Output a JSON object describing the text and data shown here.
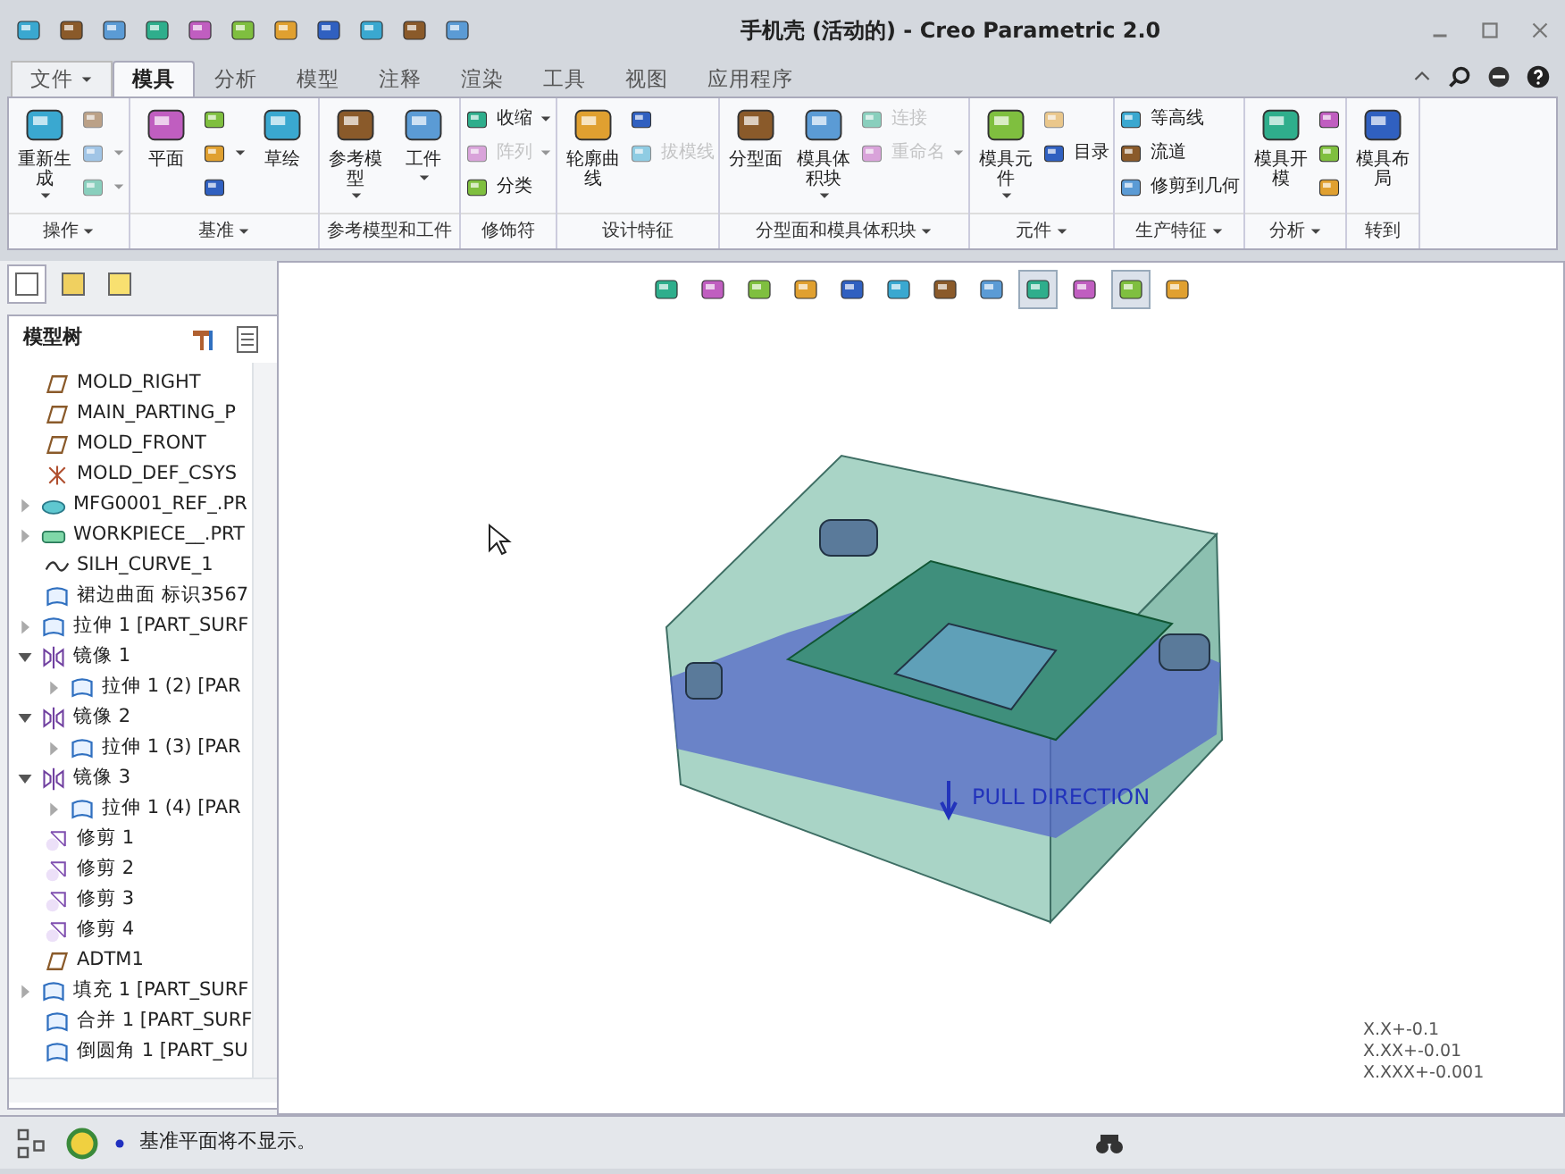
{
  "window": {
    "title": "手机壳 (活动的) - Creo Parametric 2.0"
  },
  "ribbon_tabs": [
    {
      "label": "文件",
      "kind": "menu",
      "selected": false
    },
    {
      "label": "模具",
      "kind": "tab",
      "selected": true
    },
    {
      "label": "分析",
      "kind": "tab",
      "selected": false
    },
    {
      "label": "模型",
      "kind": "tab",
      "selected": false
    },
    {
      "label": "注释",
      "kind": "tab",
      "selected": false
    },
    {
      "label": "渲染",
      "kind": "tab",
      "selected": false
    },
    {
      "label": "工具",
      "kind": "tab",
      "selected": false
    },
    {
      "label": "视图",
      "kind": "tab",
      "selected": false
    },
    {
      "label": "应用程序",
      "kind": "tab",
      "selected": false
    }
  ],
  "ribbon_groups": [
    {
      "label": "操作",
      "dropdown": true,
      "commands": [
        {
          "kind": "large",
          "label": "重新生成",
          "dropdown": true,
          "disabled": false
        },
        {
          "kind": "stack",
          "items": [
            {
              "disabled": true,
              "dropdown": false
            },
            {
              "disabled": true,
              "dropdown": true
            },
            {
              "disabled": true,
              "dropdown": true
            }
          ]
        }
      ]
    },
    {
      "label": "基准",
      "dropdown": true,
      "commands": [
        {
          "kind": "large",
          "label": "平面",
          "dropdown": false,
          "disabled": false
        },
        {
          "kind": "stack",
          "items": [
            {
              "disabled": false,
              "dropdown": false
            },
            {
              "disabled": false,
              "dropdown": true
            },
            {
              "disabled": false,
              "dropdown": false
            }
          ]
        },
        {
          "kind": "large",
          "label": "草绘",
          "dropdown": false,
          "disabled": false
        }
      ]
    },
    {
      "label": "参考模型和工件",
      "dropdown": false,
      "commands": [
        {
          "kind": "large",
          "label": "参考模型",
          "dropdown": true,
          "disabled": false
        },
        {
          "kind": "large",
          "label": "工件",
          "dropdown": true,
          "disabled": false
        }
      ]
    },
    {
      "label": "修饰符",
      "dropdown": false,
      "commands": [
        {
          "kind": "stack",
          "items": [
            {
              "label": "收缩",
              "disabled": false,
              "dropdown": true
            },
            {
              "label": "阵列",
              "disabled": true,
              "dropdown": true
            },
            {
              "label": "分类",
              "disabled": false,
              "dropdown": false
            }
          ]
        }
      ]
    },
    {
      "label": "设计特征",
      "dropdown": false,
      "commands": [
        {
          "kind": "large",
          "label": "轮廓曲线",
          "dropdown": false,
          "disabled": false
        },
        {
          "kind": "stack",
          "items": [
            {
              "disabled": false,
              "dropdown": false
            },
            {
              "label": "拔模线",
              "disabled": true,
              "dropdown": false
            }
          ]
        }
      ]
    },
    {
      "label": "分型面和模具体积块",
      "dropdown": true,
      "commands": [
        {
          "kind": "large",
          "label": "分型面",
          "dropdown": false,
          "disabled": false
        },
        {
          "kind": "large",
          "label": "模具体积块",
          "dropdown": true,
          "disabled": false
        },
        {
          "kind": "stack",
          "items": [
            {
              "label": "连接",
              "disabled": true,
              "dropdown": false
            },
            {
              "label": "重命名",
              "disabled": true,
              "dropdown": true
            }
          ]
        }
      ]
    },
    {
      "label": "元件",
      "dropdown": true,
      "commands": [
        {
          "kind": "large",
          "label": "模具元件",
          "dropdown": true,
          "disabled": false
        },
        {
          "kind": "stack",
          "items": [
            {
              "disabled": true,
              "dropdown": false
            },
            {
              "label": "目录",
              "disabled": false,
              "dropdown": false
            }
          ]
        }
      ]
    },
    {
      "label": "生产特征",
      "dropdown": true,
      "commands": [
        {
          "kind": "stack",
          "items": [
            {
              "label": "等高线",
              "disabled": false,
              "dropdown": false
            },
            {
              "label": "流道",
              "disabled": false,
              "dropdown": false
            },
            {
              "label": "修剪到几何",
              "disabled": false,
              "dropdown": false
            }
          ]
        }
      ]
    },
    {
      "label": "分析",
      "dropdown": true,
      "commands": [
        {
          "kind": "large",
          "label": "模具开模",
          "dropdown": false,
          "disabled": false
        },
        {
          "kind": "stack",
          "items": [
            {
              "disabled": false,
              "dropdown": false
            },
            {
              "disabled": false,
              "dropdown": false
            },
            {
              "disabled": false,
              "dropdown": false
            }
          ]
        }
      ]
    },
    {
      "label": "转到",
      "dropdown": false,
      "commands": [
        {
          "kind": "large",
          "label": "模具布局",
          "dropdown": false,
          "disabled": false
        }
      ]
    }
  ],
  "navigator_tabs": [
    {
      "selected": true
    },
    {
      "selected": false
    },
    {
      "selected": false
    }
  ],
  "model_tree": {
    "title": "模型树",
    "items": [
      {
        "label": "MOLD_RIGHT",
        "kind": "plane"
      },
      {
        "label": "MAIN_PARTING_P",
        "kind": "plane"
      },
      {
        "label": "MOLD_FRONT",
        "kind": "plane"
      },
      {
        "label": "MOLD_DEF_CSYS",
        "kind": "csys"
      },
      {
        "label": "MFG0001_REF_.PR",
        "kind": "part",
        "expanded": false
      },
      {
        "label": "WORKPIECE__.PRT",
        "kind": "workpiece",
        "expanded": false
      },
      {
        "label": "SILH_CURVE_1",
        "kind": "curve"
      },
      {
        "label": "裙边曲面 标识3567",
        "kind": "surface"
      },
      {
        "label": "拉伸 1 [PART_SURF",
        "kind": "surface",
        "expanded": false
      },
      {
        "label": "镜像 1",
        "kind": "mirror",
        "expanded": true,
        "children": [
          {
            "label": "拉伸 1 (2) [PAR",
            "kind": "surface",
            "expanded": false
          }
        ]
      },
      {
        "label": "镜像 2",
        "kind": "mirror",
        "expanded": true,
        "children": [
          {
            "label": "拉伸 1 (3) [PAR",
            "kind": "surface",
            "expanded": false
          }
        ]
      },
      {
        "label": "镜像 3",
        "kind": "mirror",
        "expanded": true,
        "children": [
          {
            "label": "拉伸 1 (4) [PAR",
            "kind": "surface",
            "expanded": false
          }
        ]
      },
      {
        "label": "修剪 1",
        "kind": "trim"
      },
      {
        "label": "修剪 2",
        "kind": "trim"
      },
      {
        "label": "修剪 3",
        "kind": "trim"
      },
      {
        "label": "修剪 4",
        "kind": "trim"
      },
      {
        "label": "ADTM1",
        "kind": "plane"
      },
      {
        "label": "填充 1 [PART_SURF",
        "kind": "surface",
        "expanded": false
      },
      {
        "label": "合并 1 [PART_SURF",
        "kind": "surface"
      },
      {
        "label": "倒圆角 1 [PART_SU",
        "kind": "surface"
      }
    ]
  },
  "view_toolbar": [
    {
      "selected": false
    },
    {
      "selected": false
    },
    {
      "selected": false
    },
    {
      "selected": false
    },
    {
      "selected": false
    },
    {
      "selected": false
    },
    {
      "selected": false
    },
    {
      "selected": false
    },
    {
      "selected": true
    },
    {
      "selected": false
    },
    {
      "selected": true
    },
    {
      "selected": false
    }
  ],
  "graphics": {
    "pull_direction": "PULL DIRECTION",
    "tolerances": [
      "X.X+-0.1",
      "X.XX+-0.01",
      "X.XXX+-0.001"
    ]
  },
  "status_bar": {
    "message": "基准平面将不显示。"
  }
}
